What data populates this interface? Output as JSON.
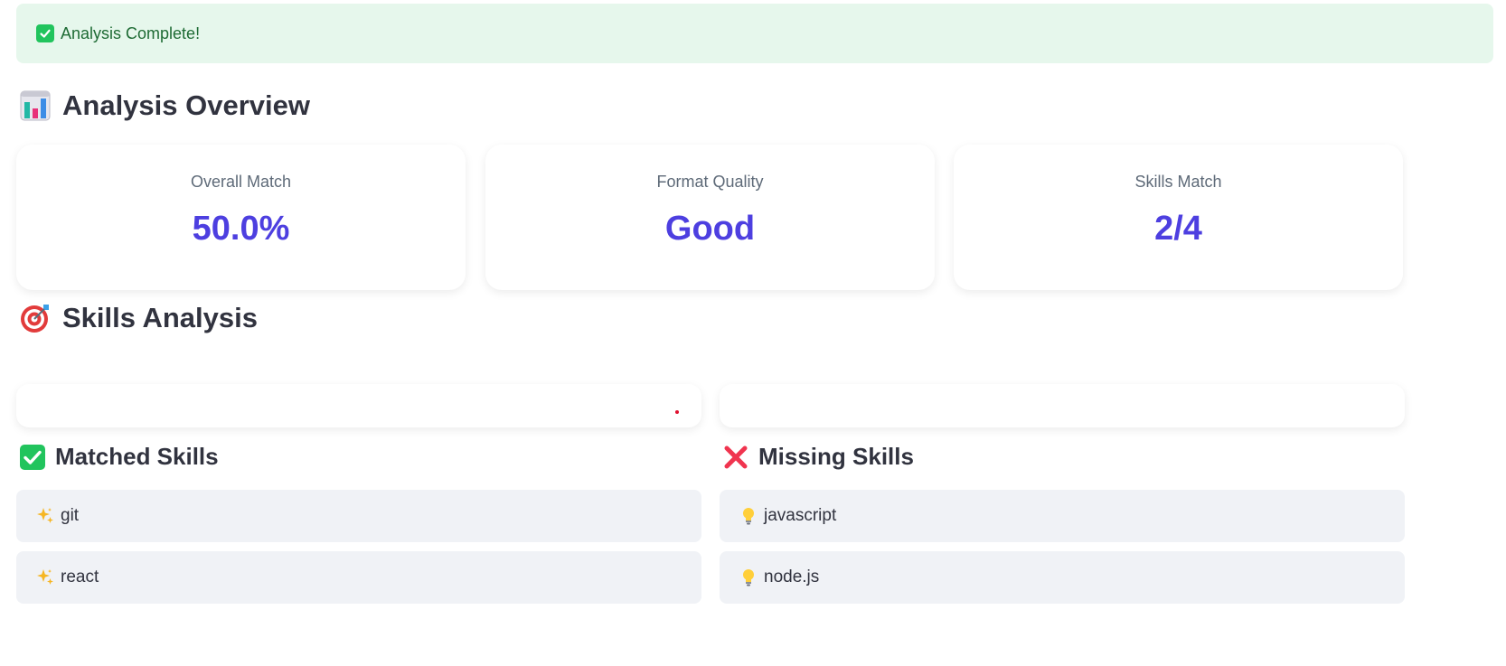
{
  "alert": {
    "text": "Analysis Complete!",
    "icon": "check-mark-button-icon",
    "color": "#21c45d"
  },
  "overview": {
    "title": "Analysis Overview",
    "icon": "bar-chart-icon",
    "metrics": [
      {
        "label": "Overall Match",
        "value": "50.0%"
      },
      {
        "label": "Format Quality",
        "value": "Good"
      },
      {
        "label": "Skills Match",
        "value": "2/4"
      }
    ],
    "accent_color": "#4d3fe0"
  },
  "skills": {
    "title": "Skills Analysis",
    "icon": "direct-hit-target-icon",
    "matched": {
      "title": "Matched Skills",
      "icon": "check-mark-button-icon",
      "item_icon": "sparkles-icon",
      "items": [
        "git",
        "react"
      ]
    },
    "missing": {
      "title": "Missing Skills",
      "icon": "cross-mark-icon",
      "item_icon": "light-bulb-icon",
      "items": [
        "javascript",
        "node.js"
      ]
    }
  }
}
